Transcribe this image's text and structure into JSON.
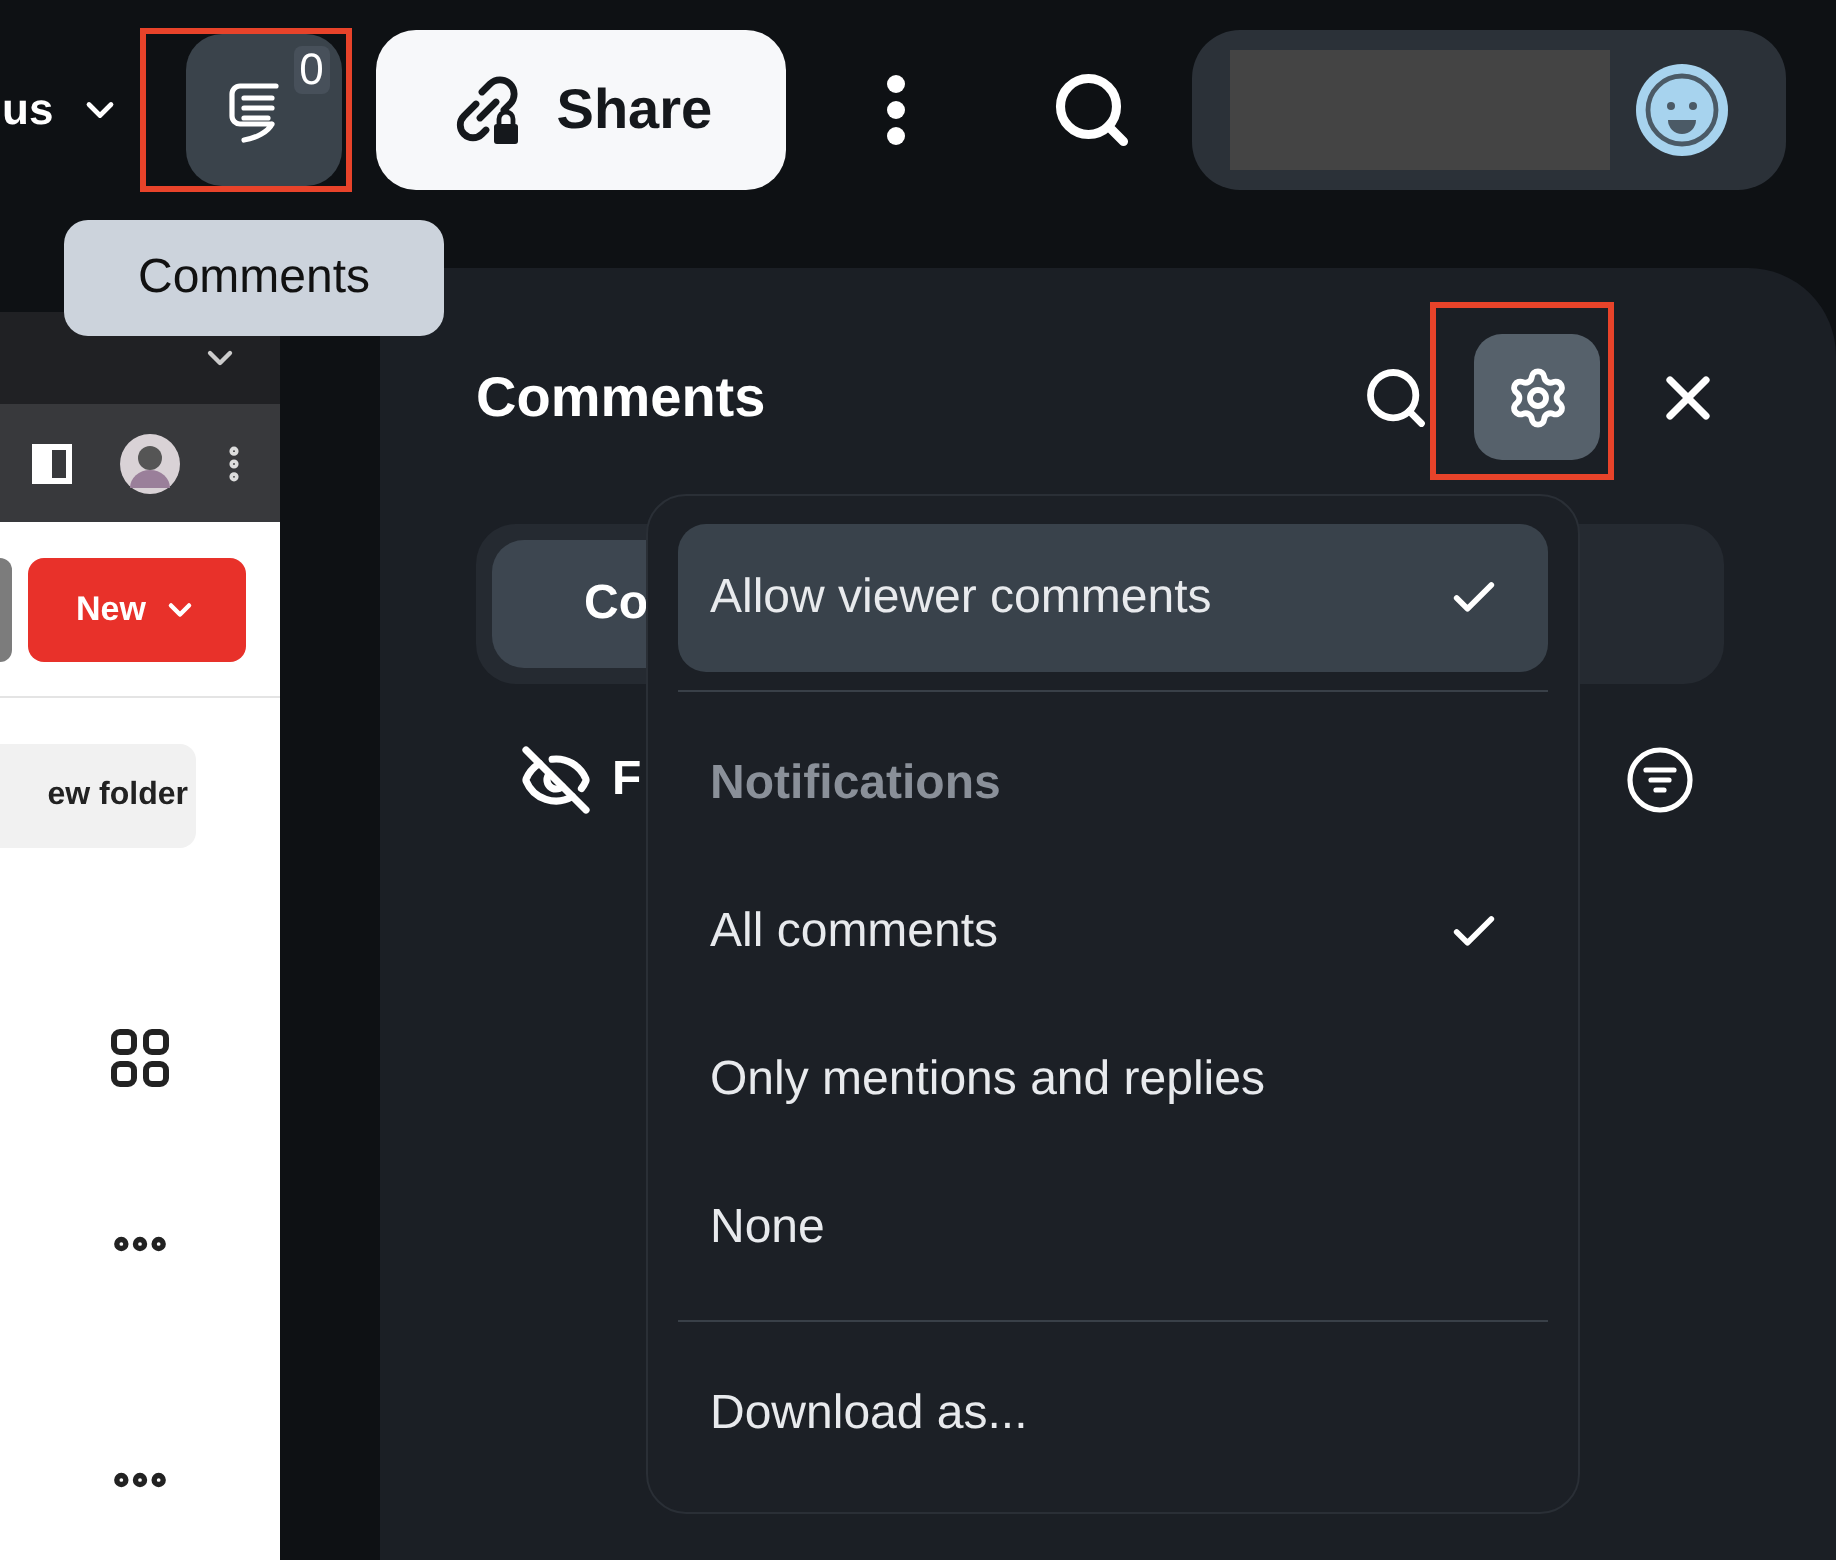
{
  "top_bar": {
    "menu_label": "us",
    "comments_button": {
      "badge": "0",
      "annotated": true
    },
    "share_button": "Share"
  },
  "tooltip": "Comments",
  "browser_panel": {
    "new_button": "New",
    "folder_button": "ew folder"
  },
  "comments_panel": {
    "title": "Comments",
    "settings_annotated": true,
    "tab": {
      "label": "Co",
      "selected": true
    },
    "filter_label": "F"
  },
  "settings_menu": {
    "items": [
      {
        "kind": "option",
        "label": "Allow viewer comments",
        "checked": true,
        "selected": true
      },
      {
        "kind": "divider"
      },
      {
        "kind": "header",
        "label": "Notifications"
      },
      {
        "kind": "option",
        "label": "All comments",
        "checked": true,
        "selected": false
      },
      {
        "kind": "option",
        "label": "Only mentions and replies",
        "checked": false,
        "selected": false
      },
      {
        "kind": "option",
        "label": "None",
        "checked": false,
        "selected": false
      },
      {
        "kind": "divider"
      },
      {
        "kind": "action",
        "label": "Download as...",
        "selected": false
      }
    ]
  }
}
